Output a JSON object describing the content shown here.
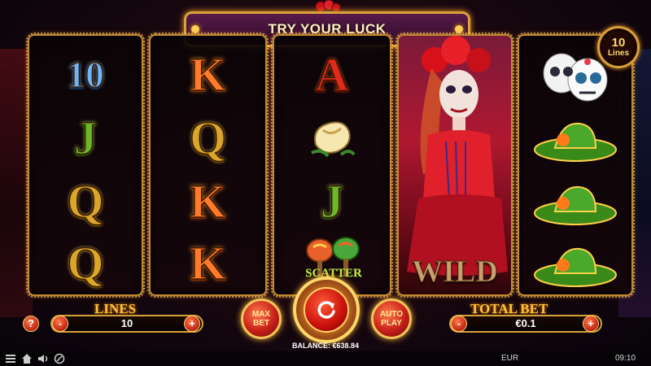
{
  "title": "TRY YOUR LUCK",
  "lines_badge": {
    "number": "10",
    "label": "Lines"
  },
  "reels": [
    {
      "symbols": [
        "10",
        "J",
        "Q",
        "Q"
      ]
    },
    {
      "symbols": [
        "K",
        "Q",
        "K",
        "K"
      ]
    },
    {
      "symbols": [
        "A",
        "bread-symbol",
        "J",
        "maracas-scatter-symbol"
      ],
      "scatter_label": "SCATTER"
    },
    {
      "symbols": [
        "catrina-wild-symbol"
      ],
      "wild_label": "WILD"
    },
    {
      "symbols": [
        "sugar-skulls-symbol",
        "sombrero-symbol",
        "sombrero-symbol",
        "sombrero-symbol"
      ]
    }
  ],
  "controls": {
    "lines_label": "LINES",
    "lines_value": "10",
    "total_bet_label": "TOTAL BET",
    "total_bet_value": "€0.1",
    "help": "?",
    "minus": "-",
    "plus": "+",
    "max_bet": "MAX BET",
    "auto_play": "AUTO PLAY",
    "balance": "BALANCE: €638.84"
  },
  "footer": {
    "icons": [
      "menu-icon",
      "home-icon",
      "sound-icon",
      "quick-spin-icon"
    ],
    "currency": "EUR",
    "time": "09:10"
  },
  "colors": {
    "gold": "#d8a23a",
    "button_red": "#c8201a",
    "label_orange": "#ffc23a"
  }
}
